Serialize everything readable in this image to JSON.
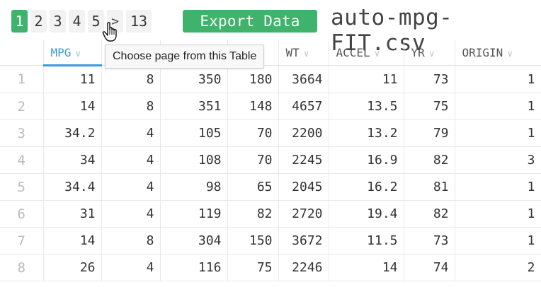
{
  "pagination": {
    "pages": [
      "1",
      "2",
      "3",
      "4",
      "5"
    ],
    "active_page": "1",
    "next_label": ">",
    "last_page": "13"
  },
  "toolbar": {
    "export_label": "Export Data",
    "file_name": "auto-mpg-FIT.csv"
  },
  "tooltip": {
    "text": "Choose page from this Table"
  },
  "table": {
    "columns": [
      "",
      "MPG",
      "",
      "",
      "WT",
      "ACCEL",
      "YR",
      "ORIGIN"
    ],
    "active_column": "MPG",
    "rows": [
      {
        "num": "1",
        "cells": [
          "11",
          "8",
          "350",
          "180",
          "3664",
          "11",
          "73",
          "1"
        ]
      },
      {
        "num": "2",
        "cells": [
          "14",
          "8",
          "351",
          "148",
          "4657",
          "13.5",
          "75",
          "1"
        ]
      },
      {
        "num": "3",
        "cells": [
          "34.2",
          "4",
          "105",
          "70",
          "2200",
          "13.2",
          "79",
          "1"
        ]
      },
      {
        "num": "4",
        "cells": [
          "34",
          "4",
          "108",
          "70",
          "2245",
          "16.9",
          "82",
          "3"
        ]
      },
      {
        "num": "5",
        "cells": [
          "34.4",
          "4",
          "98",
          "65",
          "2045",
          "16.2",
          "81",
          "1"
        ]
      },
      {
        "num": "6",
        "cells": [
          "31",
          "4",
          "119",
          "82",
          "2720",
          "19.4",
          "82",
          "1"
        ]
      },
      {
        "num": "7",
        "cells": [
          "14",
          "8",
          "304",
          "150",
          "3672",
          "11.5",
          "73",
          "1"
        ]
      },
      {
        "num": "8",
        "cells": [
          "26",
          "4",
          "116",
          "75",
          "2246",
          "14",
          "74",
          "2"
        ]
      }
    ]
  },
  "colors": {
    "accent_green": "#3fb36b",
    "accent_blue": "#3a9bd8"
  },
  "icons": {
    "sort": "chevron-down-icon",
    "cursor": "hand-pointer-icon"
  }
}
